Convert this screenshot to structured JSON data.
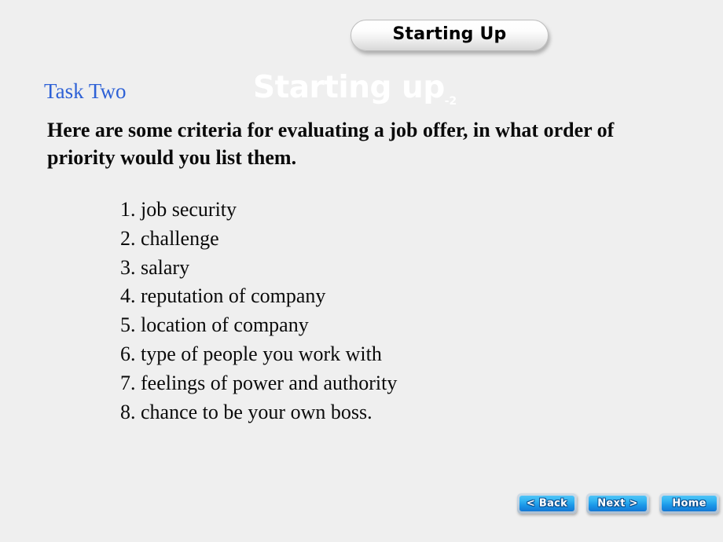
{
  "slide": {
    "background_color": "#efefef",
    "header": {
      "pill_label": "Starting Up"
    },
    "task_label": "Task Two",
    "ghost_title": {
      "text": "Starting up",
      "subscript": "-2",
      "color": "#ffffff"
    },
    "prompt": "Here are some criteria for evaluating a job offer, in what order of priority would you list them.",
    "criteria": [
      {
        "number": "1.",
        "text": "job security"
      },
      {
        "number": "2.",
        "text": "challenge"
      },
      {
        "number": "3.",
        "text": "salary"
      },
      {
        "number": "4.",
        "text": "reputation of company"
      },
      {
        "number": "5.",
        "text": "location of company"
      },
      {
        "number": "6.",
        "text": "type of people you work with"
      },
      {
        "number": "7.",
        "text": "feelings of power and authority"
      },
      {
        "number": "8.",
        "text": "chance to be your own boss."
      }
    ],
    "nav": {
      "back_label": "< Back",
      "next_label": "Next >",
      "home_label": "Home",
      "accent_color": "#1a97e8"
    },
    "colors": {
      "task_label": "#2e61d6",
      "body_text": "#0a0a0a"
    }
  }
}
